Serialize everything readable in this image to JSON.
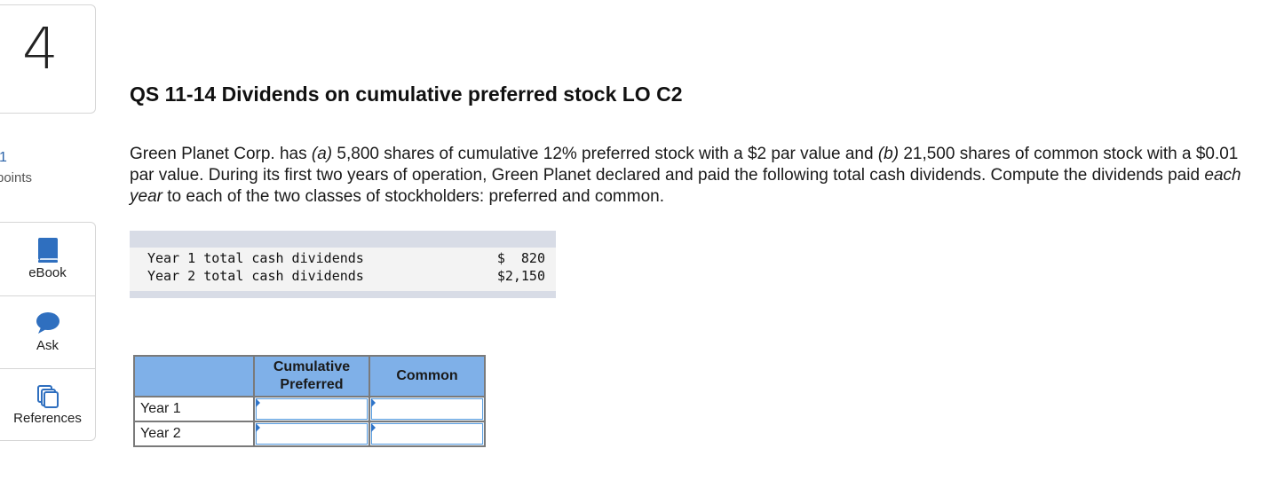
{
  "question": {
    "number": "4",
    "points_value": "1",
    "points_label": "points"
  },
  "sidebar": {
    "tools": [
      {
        "label": "eBook",
        "icon": "book-icon"
      },
      {
        "label": "Ask",
        "icon": "chat-bubble-icon"
      },
      {
        "label": "References",
        "icon": "references-icon"
      }
    ]
  },
  "title": "QS 11-14 Dividends on cumulative preferred stock LO C2",
  "paragraph": {
    "t1": "Green Planet Corp. has ",
    "a": "(a)",
    "t2": " 5,800 shares of cumulative 12% preferred stock with a $2 par value and ",
    "b": "(b)",
    "t3": " 21,500 shares of common stock with a $0.01 par value. During its first two years of operation, Green Planet declared and paid the following total cash dividends. Compute the dividends paid ",
    "each_year": "each year",
    "t4": " to each of the two classes of stockholders: preferred and common."
  },
  "given": {
    "rows": [
      {
        "label": "Year 1 total cash dividends",
        "value": "$  820"
      },
      {
        "label": "Year 2 total cash dividends",
        "value": "$2,150"
      }
    ]
  },
  "answer_table": {
    "headers": [
      "",
      "Cumulative Preferred",
      "Common"
    ],
    "rows": [
      {
        "label": "Year 1",
        "preferred": "",
        "common": ""
      },
      {
        "label": "Year 2",
        "preferred": "",
        "common": ""
      }
    ]
  },
  "colors": {
    "accent": "#2a62a8",
    "header_fill": "#7fb0e8",
    "icon_blue": "#2f6fbf"
  }
}
